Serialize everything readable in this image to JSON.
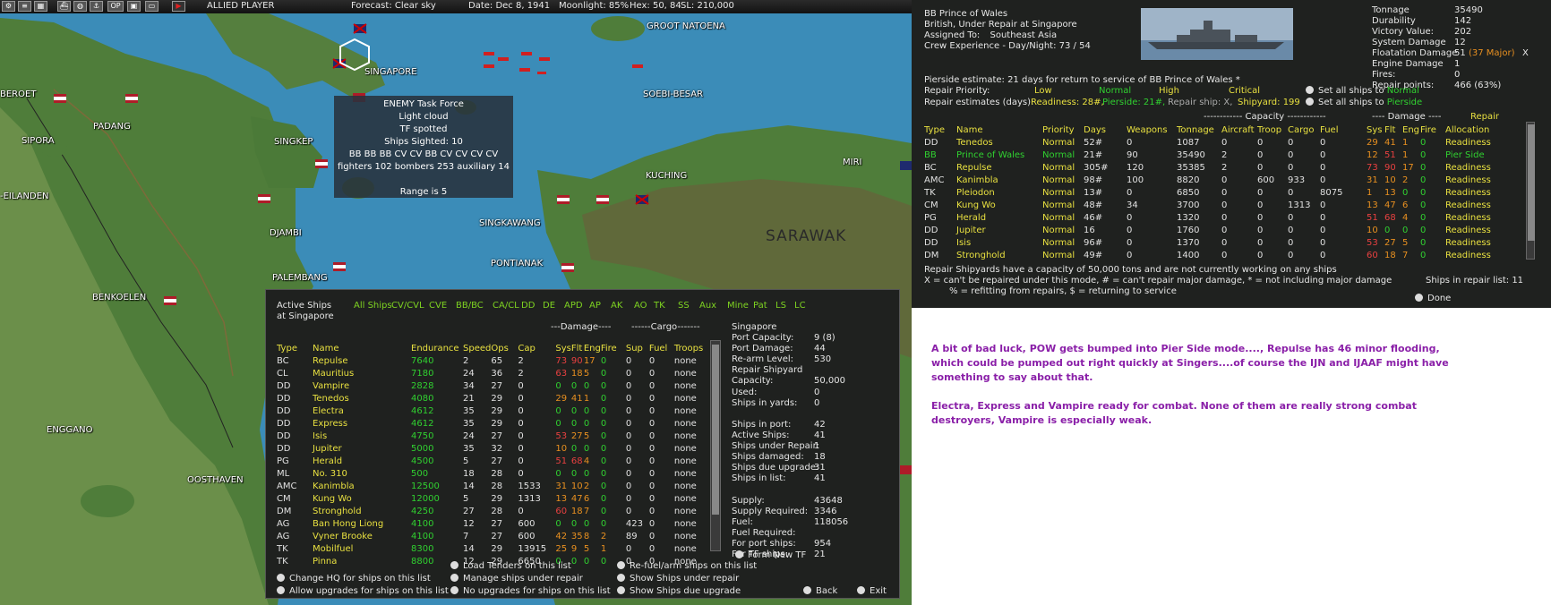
{
  "topbar": {
    "player": "ALLIED PLAYER",
    "forecast": "Forecast: Clear sky",
    "date": "Date: Dec 8, 1941",
    "moonlight": "Moonlight: 85%",
    "hex": "Hex: 50, 84",
    "sl": "SL: 210,000",
    "icons": [
      "gear-icon",
      "list-icon",
      "globe-icon",
      "ships-icon",
      "anchor-icon",
      "OP",
      "disk-icon",
      "play-icon"
    ],
    "icon_op": "OP"
  },
  "map": {
    "labels": [
      "GROOT NATOENA",
      "SINGAPORE",
      "BEROET",
      "PADANG",
      "SIPORA",
      "SOEBI-BESAR",
      "SINGKEP",
      "MIRI",
      "KUCHING",
      "-EILANDEN",
      "DJAMBI",
      "SINGKAWANG",
      "SARAWAK",
      "PONTIANAK",
      "PALEMBANG",
      "BENKOELEN",
      "ENGGANO",
      "OOSTHAVEN"
    ]
  },
  "tooltip": {
    "lines": [
      "ENEMY Task Force",
      "Light cloud",
      "TF spotted",
      "Ships Sighted: 10",
      "BB BB BB CV CV BB CV CV CV CV",
      "fighters 102  bombers 253  auxiliary 14",
      "",
      "Range is 5"
    ]
  },
  "ships_panel": {
    "title1": "Active Ships",
    "title2": "at Singapore",
    "tabs": [
      "All Ships",
      "CV/CVL",
      "CVE",
      "BB/BC",
      "CA/CL",
      "DD",
      "DE",
      "APD",
      "AP",
      "AK",
      "AO",
      "TK",
      "SS",
      "Aux",
      "Mine",
      "Pat",
      "LS",
      "LC"
    ],
    "damage_header": "---Damage----",
    "cargo_header": "------Cargo-------",
    "columns": [
      "Type",
      "Name",
      "Endurance",
      "Speed",
      "Ops",
      "Cap",
      "Sys",
      "Flt",
      "Eng",
      "Fire",
      "Sup",
      "Fuel",
      "Troops"
    ],
    "rows": [
      [
        "BC",
        "Repulse",
        "7640",
        "2",
        "65",
        "2",
        "73",
        "90",
        "17",
        "0",
        "0",
        "0",
        "none"
      ],
      [
        "CL",
        "Mauritius",
        "7180",
        "24",
        "36",
        "2",
        "63",
        "18",
        "5",
        "0",
        "0",
        "0",
        "none"
      ],
      [
        "DD",
        "Vampire",
        "2828",
        "34",
        "27",
        "0",
        "0",
        "0",
        "0",
        "0",
        "0",
        "0",
        "none"
      ],
      [
        "DD",
        "Tenedos",
        "4080",
        "21",
        "29",
        "0",
        "29",
        "41",
        "1",
        "0",
        "0",
        "0",
        "none"
      ],
      [
        "DD",
        "Electra",
        "4612",
        "35",
        "29",
        "0",
        "0",
        "0",
        "0",
        "0",
        "0",
        "0",
        "none"
      ],
      [
        "DD",
        "Express",
        "4612",
        "35",
        "29",
        "0",
        "0",
        "0",
        "0",
        "0",
        "0",
        "0",
        "none"
      ],
      [
        "DD",
        "Isis",
        "4750",
        "24",
        "27",
        "0",
        "53",
        "27",
        "5",
        "0",
        "0",
        "0",
        "none"
      ],
      [
        "DD",
        "Jupiter",
        "5000",
        "35",
        "32",
        "0",
        "10",
        "0",
        "0",
        "0",
        "0",
        "0",
        "none"
      ],
      [
        "PG",
        "Herald",
        "4500",
        "5",
        "27",
        "0",
        "51",
        "68",
        "4",
        "0",
        "0",
        "0",
        "none"
      ],
      [
        "ML",
        "No. 310",
        "500",
        "18",
        "28",
        "0",
        "0",
        "0",
        "0",
        "0",
        "0",
        "0",
        "none"
      ],
      [
        "AMC",
        "Kanimbla",
        "12500",
        "14",
        "28",
        "1533",
        "31",
        "10",
        "2",
        "0",
        "0",
        "0",
        "none"
      ],
      [
        "CM",
        "Kung Wo",
        "12000",
        "5",
        "29",
        "1313",
        "13",
        "47",
        "6",
        "0",
        "0",
        "0",
        "none"
      ],
      [
        "DM",
        "Stronghold",
        "4250",
        "27",
        "28",
        "0",
        "60",
        "18",
        "7",
        "0",
        "0",
        "0",
        "none"
      ],
      [
        "AG",
        "Ban Hong Liong",
        "4100",
        "12",
        "27",
        "600",
        "0",
        "0",
        "0",
        "0",
        "423",
        "0",
        "none"
      ],
      [
        "AG",
        "Vyner Brooke",
        "4100",
        "7",
        "27",
        "600",
        "42",
        "35",
        "8",
        "2",
        "89",
        "0",
        "none"
      ],
      [
        "TK",
        "Mobilfuel",
        "8300",
        "14",
        "29",
        "13915",
        "25",
        "9",
        "5",
        "1",
        "0",
        "0",
        "none"
      ],
      [
        "TK",
        "Pinna",
        "8800",
        "12",
        "29",
        "6650",
        "0",
        "0",
        "0",
        "0",
        "0",
        "0",
        "none"
      ]
    ],
    "port_info": [
      [
        "Singapore",
        ""
      ],
      [
        "Port Capacity:",
        "9 (8)"
      ],
      [
        "Port Damage:",
        "44"
      ],
      [
        "Re-arm Level:",
        "530"
      ],
      [
        "Repair Shipyard",
        ""
      ],
      [
        "  Capacity:",
        "50,000"
      ],
      [
        "  Used:",
        "0"
      ],
      [
        "  Ships in yards:",
        "0"
      ],
      [
        "",
        ""
      ],
      [
        "Ships in port:",
        "42"
      ],
      [
        "Active Ships:",
        "41"
      ],
      [
        "Ships under Repair:",
        "1"
      ],
      [
        "Ships damaged:",
        "18"
      ],
      [
        "Ships due upgrade:",
        "31"
      ],
      [
        "Ships in list:",
        "41"
      ],
      [
        "",
        ""
      ],
      [
        "Supply:",
        "43648"
      ],
      [
        "Supply Required:",
        "3346"
      ],
      [
        "Fuel:",
        "118056"
      ],
      [
        "Fuel Required:",
        ""
      ],
      [
        "  For port ships:",
        "954"
      ],
      [
        "  For TF ships:",
        "21"
      ]
    ],
    "form_new_tf": "Form New TF",
    "buttons": [
      "Change HQ for ships on this list",
      "Allow upgrades for ships on this list",
      "Load Tenders on this list",
      "Manage ships under repair",
      "No upgrades for ships on this list",
      "Re-fuel/arm ships on this list",
      "Show Ships under repair",
      "Show Ships due upgrade",
      "Back",
      "Exit"
    ]
  },
  "info_panel": {
    "ship_name": "BB Prince of Wales",
    "status": "British, Under Repair at Singapore",
    "assigned_label": "Assigned To:",
    "assigned": "Southeast Asia",
    "crew": "Crew Experience - Day/Night:  73  /  54",
    "stats": [
      [
        "Tonnage",
        "35490"
      ],
      [
        "Durability",
        "142"
      ],
      [
        "Victory Value:",
        "202"
      ],
      [
        "System Damage",
        "12"
      ],
      [
        "Floatation Damage",
        "51"
      ],
      [
        "Engine Damage",
        "1"
      ],
      [
        "Fires:",
        "0"
      ],
      [
        "Repair points:",
        "466 (63%)"
      ]
    ],
    "flot_major": "(37 Major)",
    "close_x": "X",
    "pierside": "Pierside estimate: 21 days for return to service of BB Prince of Wales *",
    "priority_label": "Repair Priority:",
    "priorities": [
      "Low",
      "Normal",
      "High",
      "Critical"
    ],
    "estimates_label": "Repair estimates (days):",
    "readiness": "Readiness: 28#,",
    "pierside_est": "Pierside: 21#,",
    "repair_ship": "Repair ship: X,",
    "shipyard": "Shipyard: 199",
    "set_all_normal": "Set all ships to",
    "set_all_normal_val": "Normal",
    "set_all_pier": "Set all ships to",
    "set_all_pier_val": "Pierside",
    "cap_header": "------------ Capacity ------------",
    "dmg_header": "---- Damage ----",
    "repair_header": "Repair",
    "columns": [
      "Type",
      "Name",
      "Priority",
      "Days",
      "Weapons",
      "Tonnage",
      "Aircraft",
      "Troop",
      "Cargo",
      "Fuel",
      "Sys",
      "Flt",
      "Eng",
      "Fire",
      "Allocation"
    ],
    "rows": [
      [
        "DD",
        "Tenedos",
        "Normal",
        "52#",
        "0",
        "1087",
        "0",
        "0",
        "0",
        "0",
        "29",
        "41",
        "1",
        "0",
        "Readiness"
      ],
      [
        "BB",
        "Prince of Wales",
        "Normal",
        "21#",
        "90",
        "35490",
        "2",
        "0",
        "0",
        "0",
        "12",
        "51",
        "1",
        "0",
        "Pier Side"
      ],
      [
        "BC",
        "Repulse",
        "Normal",
        "305#",
        "120",
        "35385",
        "2",
        "0",
        "0",
        "0",
        "73",
        "90",
        "17",
        "0",
        "Readiness"
      ],
      [
        "AMC",
        "Kanimbla",
        "Normal",
        "98#",
        "100",
        "8820",
        "0",
        "600",
        "933",
        "0",
        "31",
        "10",
        "2",
        "0",
        "Readiness"
      ],
      [
        "TK",
        "Pleiodon",
        "Normal",
        "13#",
        "0",
        "6850",
        "0",
        "0",
        "0",
        "8075",
        "1",
        "13",
        "0",
        "0",
        "Readiness"
      ],
      [
        "CM",
        "Kung Wo",
        "Normal",
        "48#",
        "34",
        "3700",
        "0",
        "0",
        "1313",
        "0",
        "13",
        "47",
        "6",
        "0",
        "Readiness"
      ],
      [
        "PG",
        "Herald",
        "Normal",
        "46#",
        "0",
        "1320",
        "0",
        "0",
        "0",
        "0",
        "51",
        "68",
        "4",
        "0",
        "Readiness"
      ],
      [
        "DD",
        "Jupiter",
        "Normal",
        "16",
        "0",
        "1760",
        "0",
        "0",
        "0",
        "0",
        "10",
        "0",
        "0",
        "0",
        "Readiness"
      ],
      [
        "DD",
        "Isis",
        "Normal",
        "96#",
        "0",
        "1370",
        "0",
        "0",
        "0",
        "0",
        "53",
        "27",
        "5",
        "0",
        "Readiness"
      ],
      [
        "DM",
        "Stronghold",
        "Normal",
        "49#",
        "0",
        "1400",
        "0",
        "0",
        "0",
        "0",
        "60",
        "18",
        "7",
        "0",
        "Readiness"
      ]
    ],
    "footer1": "Repair Shipyards have a capacity of 50,000 tons and are not currently working on any ships",
    "footer2": "X = can't be repaired under this mode, # = can't repair major damage, * = not including major damage",
    "footer3": "% = refitting from repairs, $ = returning to service",
    "ships_in_repair": "Ships in repair list: 11",
    "done": "Done"
  },
  "note": {
    "p1": "A bit of bad luck, POW gets bumped into Pier Side mode...., Repulse has 46 minor flooding, which could be pumped out right quickly at Singers....of course the IJN and IJAAF might have something to say about that.",
    "p2": "Electra, Express and Vampire ready for combat. None of them are really strong combat destroyers, Vampire is especially weak."
  }
}
